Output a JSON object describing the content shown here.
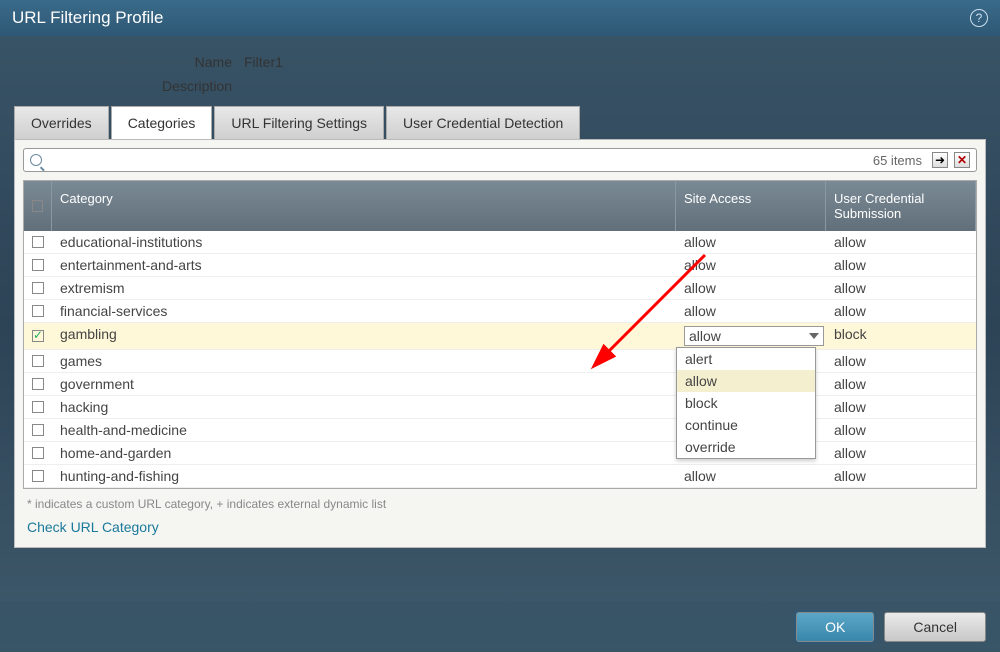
{
  "title": "URL Filtering Profile",
  "form": {
    "name_label": "Name",
    "name_value": "Filter1",
    "desc_label": "Description",
    "desc_value": ""
  },
  "tabs": {
    "overrides": "Overrides",
    "categories": "Categories",
    "settings": "URL Filtering Settings",
    "ucd": "User Credential Detection"
  },
  "toolbar": {
    "items_text": "65 items"
  },
  "columns": {
    "category": "Category",
    "site_access": "Site Access",
    "user_cred": "User Credential Submission"
  },
  "rows": [
    {
      "checked": false,
      "name": "educational-institutions",
      "sa": "allow",
      "uc": "allow"
    },
    {
      "checked": false,
      "name": "entertainment-and-arts",
      "sa": "allow",
      "uc": "allow"
    },
    {
      "checked": false,
      "name": "extremism",
      "sa": "allow",
      "uc": "allow"
    },
    {
      "checked": false,
      "name": "financial-services",
      "sa": "allow",
      "uc": "allow"
    },
    {
      "checked": true,
      "name": "gambling",
      "sa": "allow",
      "uc": "block",
      "selected": true,
      "dropdown_open": true
    },
    {
      "checked": false,
      "name": "games",
      "sa": "",
      "uc": "allow"
    },
    {
      "checked": false,
      "name": "government",
      "sa": "",
      "uc": "allow"
    },
    {
      "checked": false,
      "name": "hacking",
      "sa": "",
      "uc": "allow"
    },
    {
      "checked": false,
      "name": "health-and-medicine",
      "sa": "",
      "uc": "allow"
    },
    {
      "checked": false,
      "name": "home-and-garden",
      "sa": "",
      "uc": "allow"
    },
    {
      "checked": false,
      "name": "hunting-and-fishing",
      "sa": "allow",
      "uc": "allow"
    }
  ],
  "dropdown_options": [
    "alert",
    "allow",
    "block",
    "continue",
    "override"
  ],
  "dropdown_highlight": "allow",
  "footnote": "* indicates a custom URL category, + indicates external dynamic list",
  "link": "Check URL Category",
  "buttons": {
    "ok": "OK",
    "cancel": "Cancel"
  }
}
